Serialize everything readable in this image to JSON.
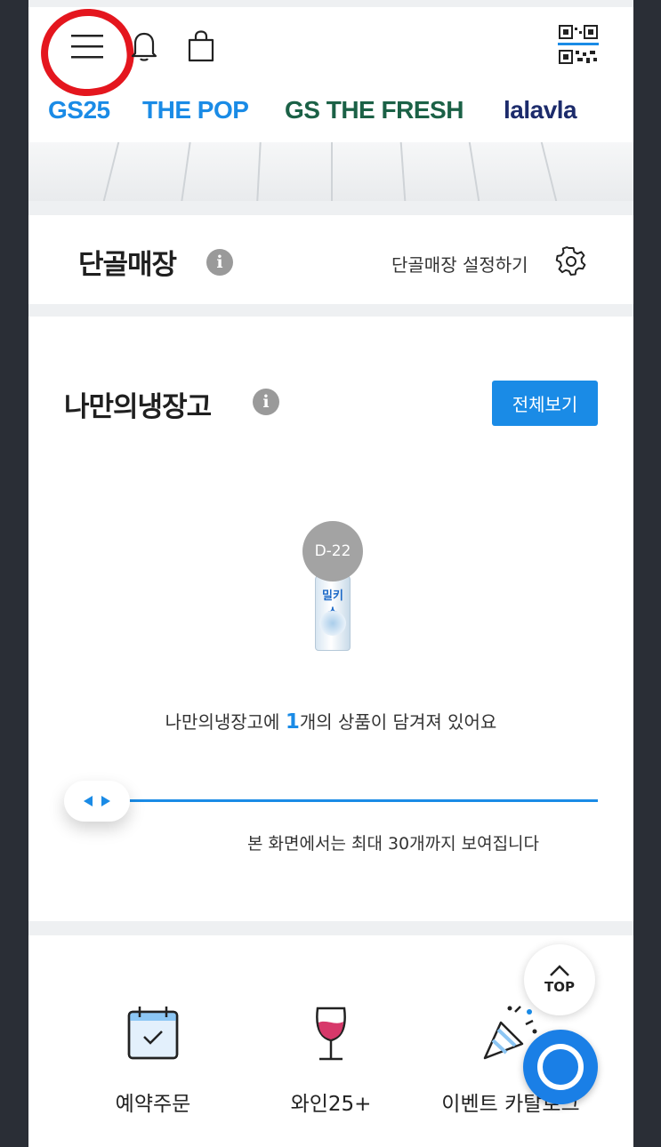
{
  "brand_tabs": [
    {
      "label": "GS25",
      "active": true
    },
    {
      "label": "THE POP",
      "active": false
    },
    {
      "label": "GS THE FRESH",
      "active": false
    },
    {
      "label": "lalavla",
      "active": false
    }
  ],
  "icons": {
    "menu": "hamburger-menu-icon",
    "bell": "bell-icon",
    "bag": "shopping-bag-icon",
    "qr": "qr-code-icon",
    "gear": "gear-icon",
    "info": "info-icon"
  },
  "regular_store": {
    "title": "단골매장",
    "info_glyph": "i",
    "setting_label": "단골매장 설정하기"
  },
  "fridge": {
    "title": "나만의냉장고",
    "info_glyph": "i",
    "view_all_label": "전체보기",
    "product": {
      "dday": "D-22",
      "can_label": "밀키스"
    },
    "message_before": "나만의냉장고에 ",
    "message_count": "1",
    "message_after": "개의 상품이 담겨져 있어요",
    "slider_note": "본 화면에서는 최대 30개까지 보여집니다"
  },
  "menu_items": [
    {
      "label": "예약주문",
      "icon": "calendar-check-icon"
    },
    {
      "label": "와인25+",
      "icon": "wine-glass-icon"
    },
    {
      "label": "이벤트 카탈로그",
      "icon": "party-popper-icon"
    }
  ],
  "top_button": {
    "label": "TOP"
  },
  "colors": {
    "accent": "#1a8be6",
    "fresh_green": "#1b6146",
    "lalavla_navy": "#1c2b6b",
    "annotation_red": "#e4161e"
  }
}
